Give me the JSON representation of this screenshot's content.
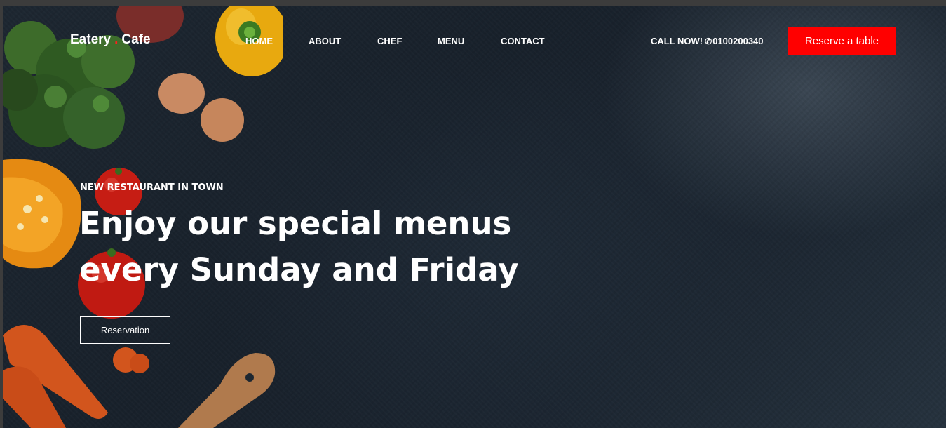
{
  "brand": {
    "name_first": "Eatery",
    "separator": ".",
    "name_second": "Cafe",
    "accent_color": "#ff0000"
  },
  "nav": {
    "items": [
      "HOME",
      "ABOUT",
      "CHEF",
      "MENU",
      "CONTACT"
    ]
  },
  "header_cta": {
    "call_label": "CALL NOW!",
    "phone_icon": "phone-icon",
    "phone_number": "0100200340",
    "reserve_label": "Reserve a table"
  },
  "hero": {
    "eyebrow": "NEW RESTAURANT IN TOWN",
    "headline": "Enjoy our special menus every Sunday and Friday",
    "button_label": "Reservation"
  }
}
